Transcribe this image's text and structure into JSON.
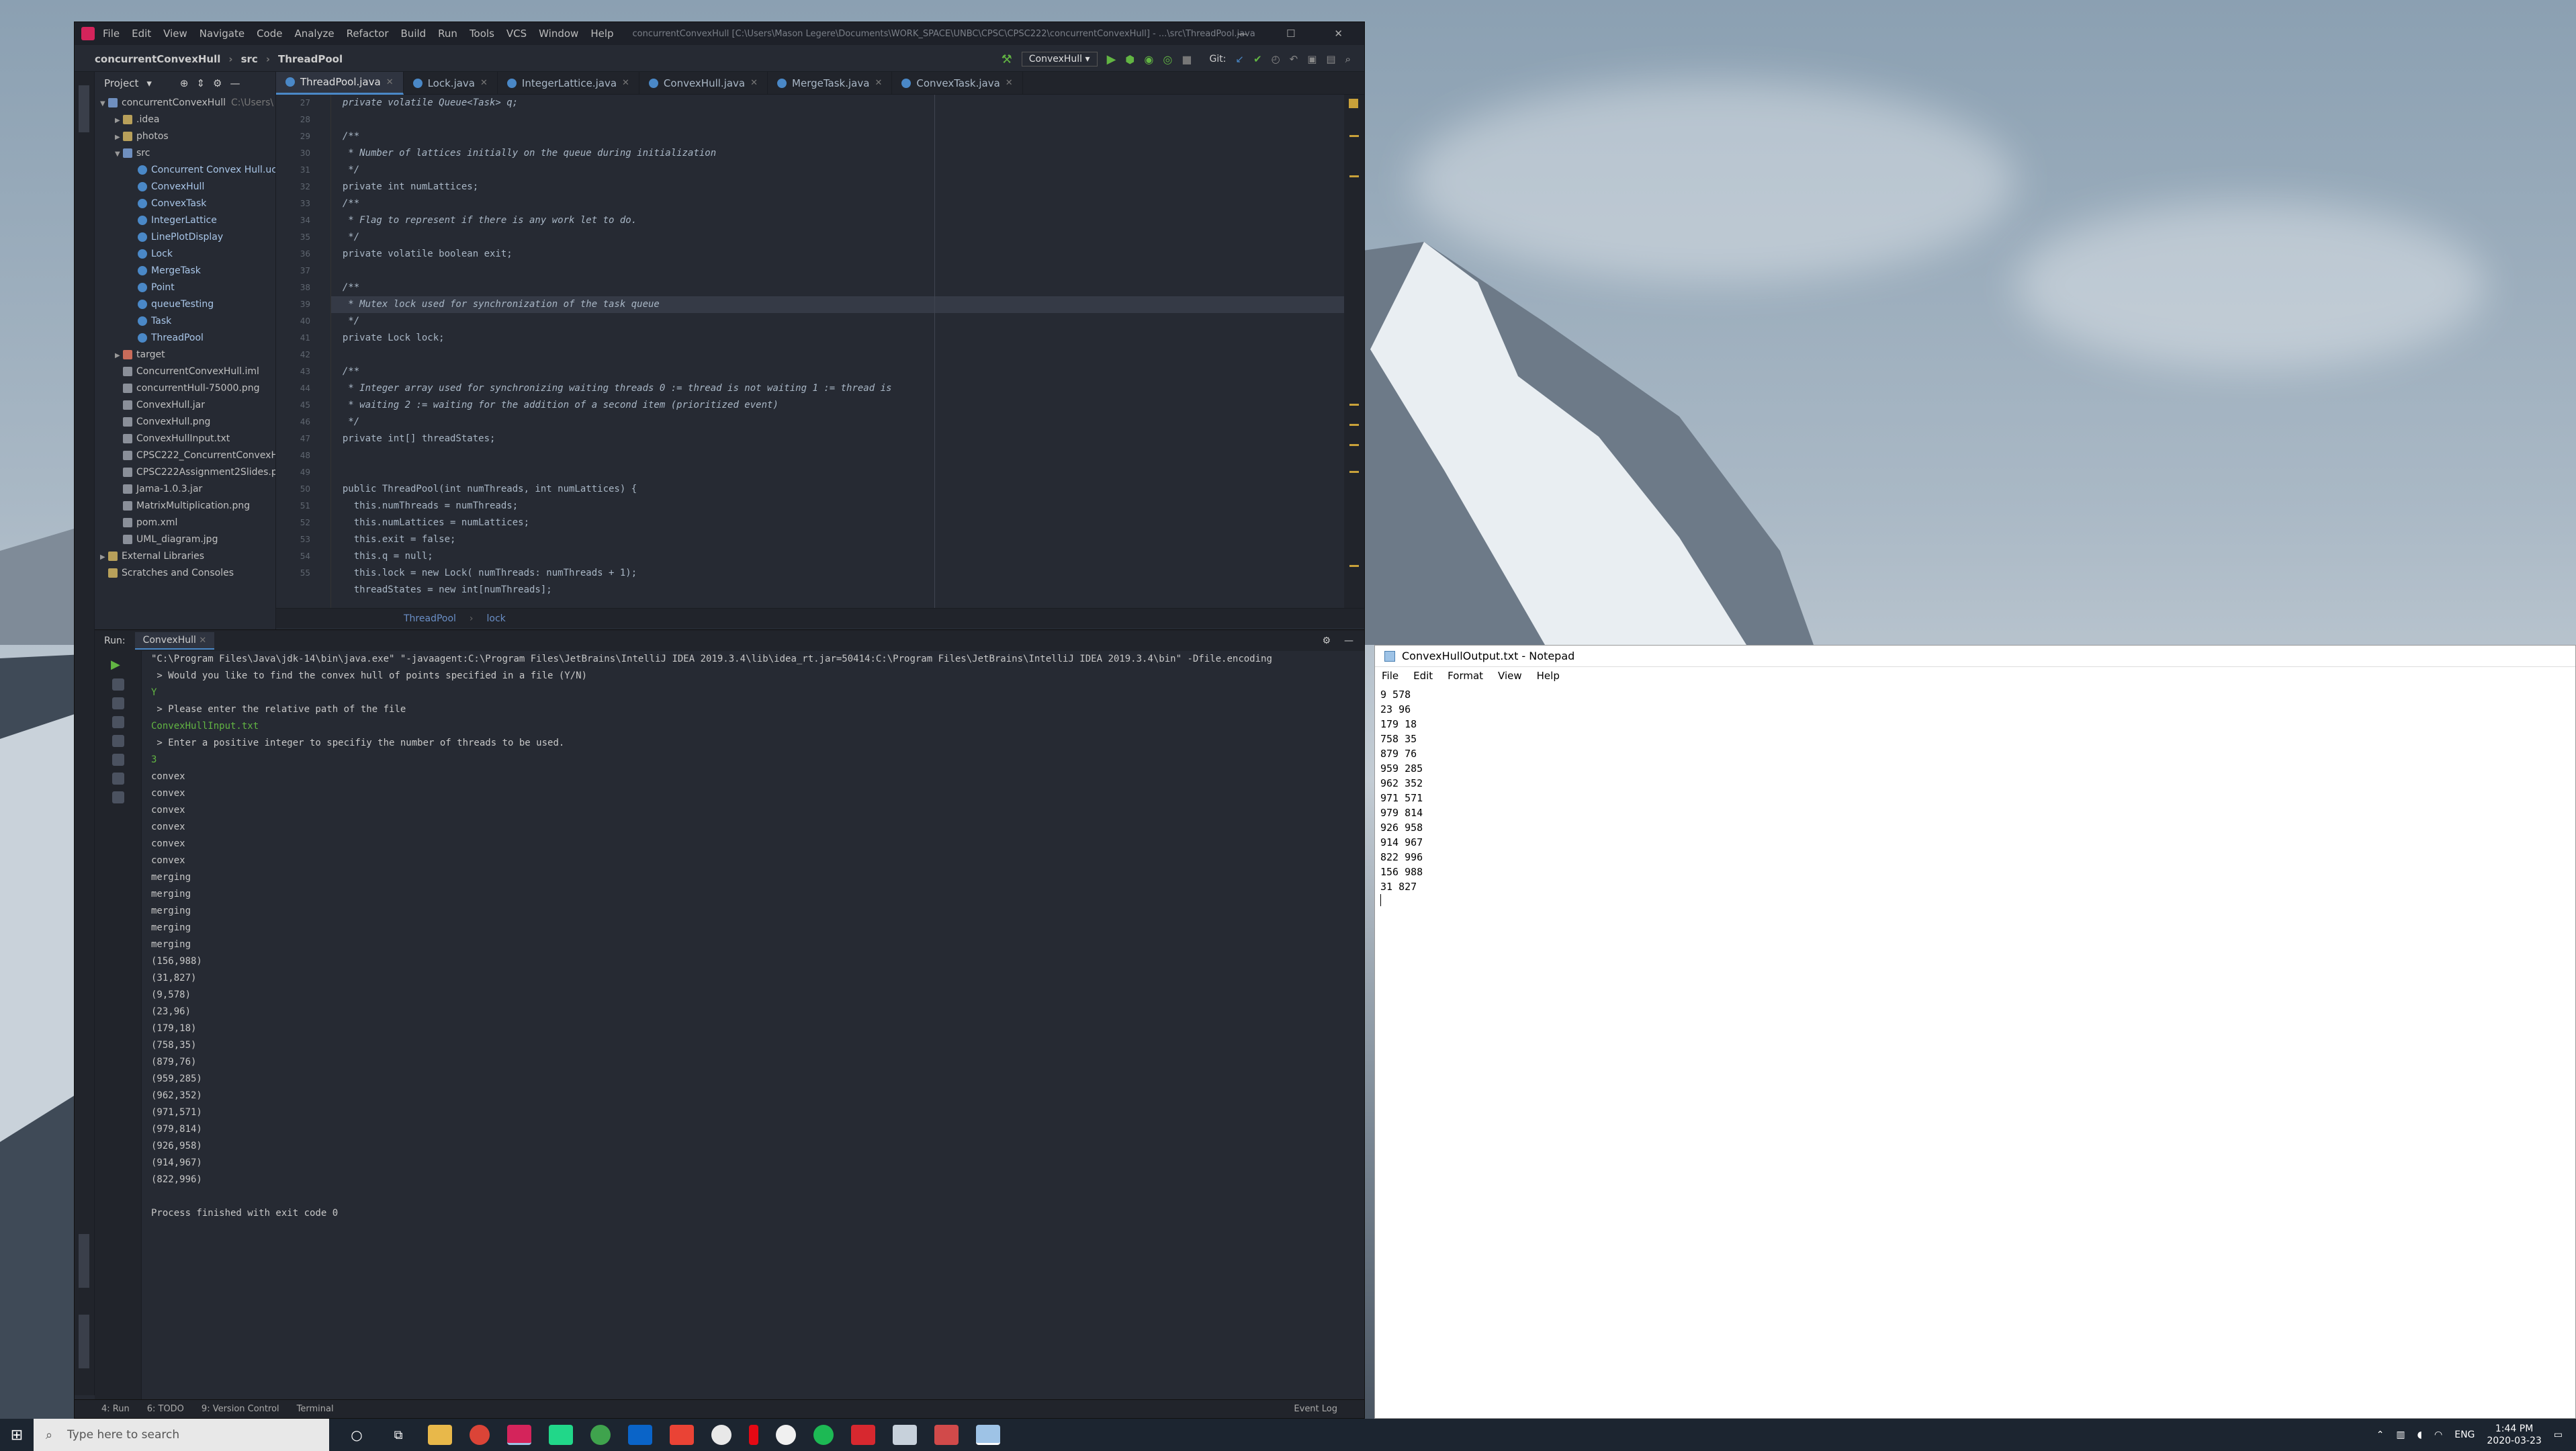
{
  "ide": {
    "menu": [
      "File",
      "Edit",
      "View",
      "Navigate",
      "Code",
      "Analyze",
      "Refactor",
      "Build",
      "Run",
      "Tools",
      "VCS",
      "Window",
      "Help"
    ],
    "title_path": "concurrentConvexHull [C:\\Users\\Mason Legere\\Documents\\WORK_SPACE\\UNBC\\CPSC\\CPSC222\\concurrentConvexHull] - ...\\src\\ThreadPool.java",
    "breadcrumb": [
      "concurrentConvexHull",
      "src",
      "ThreadPool"
    ],
    "run_config": "ConvexHull",
    "git_label": "Git:",
    "tabs": [
      "ThreadPool.java",
      "Lock.java",
      "IntegerLattice.java",
      "ConvexHull.java",
      "MergeTask.java",
      "ConvexTask.java"
    ],
    "project_label": "Project",
    "tree": [
      {
        "indent": 0,
        "arrow": "▼",
        "icon": "folder blue",
        "label": "concurrentConvexHull",
        "note": "C:\\Users\\"
      },
      {
        "indent": 1,
        "arrow": "▶",
        "icon": "folder",
        "label": ".idea"
      },
      {
        "indent": 1,
        "arrow": "▶",
        "icon": "folder",
        "label": "photos"
      },
      {
        "indent": 1,
        "arrow": "▼",
        "icon": "folder blue",
        "label": "src"
      },
      {
        "indent": 2,
        "arrow": "",
        "icon": "class",
        "label": "Concurrent Convex Hull.uc"
      },
      {
        "indent": 2,
        "arrow": "",
        "icon": "class",
        "label": "ConvexHull"
      },
      {
        "indent": 2,
        "arrow": "",
        "icon": "class",
        "label": "ConvexTask"
      },
      {
        "indent": 2,
        "arrow": "",
        "icon": "class",
        "label": "IntegerLattice"
      },
      {
        "indent": 2,
        "arrow": "",
        "icon": "class",
        "label": "LinePlotDisplay"
      },
      {
        "indent": 2,
        "arrow": "",
        "icon": "class",
        "label": "Lock"
      },
      {
        "indent": 2,
        "arrow": "",
        "icon": "class",
        "label": "MergeTask"
      },
      {
        "indent": 2,
        "arrow": "",
        "icon": "class",
        "label": "Point"
      },
      {
        "indent": 2,
        "arrow": "",
        "icon": "class",
        "label": "queueTesting"
      },
      {
        "indent": 2,
        "arrow": "",
        "icon": "class",
        "label": "Task"
      },
      {
        "indent": 2,
        "arrow": "",
        "icon": "class",
        "label": "ThreadPool"
      },
      {
        "indent": 1,
        "arrow": "▶",
        "icon": "folder red",
        "label": "target"
      },
      {
        "indent": 1,
        "arrow": "",
        "icon": "file",
        "label": "ConcurrentConvexHull.iml"
      },
      {
        "indent": 1,
        "arrow": "",
        "icon": "file",
        "label": "concurrentHull-75000.png"
      },
      {
        "indent": 1,
        "arrow": "",
        "icon": "file",
        "label": "ConvexHull.jar"
      },
      {
        "indent": 1,
        "arrow": "",
        "icon": "file",
        "label": "ConvexHull.png"
      },
      {
        "indent": 1,
        "arrow": "",
        "icon": "file",
        "label": "ConvexHullInput.txt"
      },
      {
        "indent": 1,
        "arrow": "",
        "icon": "file",
        "label": "CPSC222_ConcurrentConvexH"
      },
      {
        "indent": 1,
        "arrow": "",
        "icon": "file",
        "label": "CPSC222Assignment2Slides.p"
      },
      {
        "indent": 1,
        "arrow": "",
        "icon": "file",
        "label": "Jama-1.0.3.jar"
      },
      {
        "indent": 1,
        "arrow": "",
        "icon": "file",
        "label": "MatrixMultiplication.png"
      },
      {
        "indent": 1,
        "arrow": "",
        "icon": "file",
        "label": "pom.xml"
      },
      {
        "indent": 1,
        "arrow": "",
        "icon": "file",
        "label": "UML_diagram.jpg"
      },
      {
        "indent": 0,
        "arrow": "▶",
        "icon": "folder",
        "label": "External Libraries"
      },
      {
        "indent": 0,
        "arrow": "",
        "icon": "folder",
        "label": "Scratches and Consoles"
      }
    ],
    "line_numbers": [
      "27",
      "28",
      "29",
      "30",
      "31",
      "32",
      "33",
      "34",
      "35",
      "36",
      "37",
      "38",
      "39",
      "40",
      "41",
      "42",
      "43",
      "44",
      "45",
      "46",
      "47",
      "48",
      "49",
      "50",
      "51",
      "52",
      "53",
      "54",
      "55"
    ],
    "code": [
      {
        "t": "  private volatile Queue<Task> q;",
        "c": "cm"
      },
      {
        "t": "",
        "c": ""
      },
      {
        "t": "  /**",
        "c": "cm"
      },
      {
        "t": "   * Number of lattices initially on the queue during initialization",
        "c": "cm"
      },
      {
        "t": "   */",
        "c": "cm"
      },
      {
        "t": "  private int numLattices;",
        "c": ""
      },
      {
        "t": "  /**",
        "c": "cm"
      },
      {
        "t": "   * Flag to represent if there is any work let to do.",
        "c": "cm"
      },
      {
        "t": "   */",
        "c": "cm"
      },
      {
        "t": "  private volatile boolean exit;",
        "c": ""
      },
      {
        "t": "",
        "c": ""
      },
      {
        "t": "  /**",
        "c": "cm"
      },
      {
        "t": "   * Mutex lock used for synchronization of the task queue",
        "c": "cm hl"
      },
      {
        "t": "   */",
        "c": "cm"
      },
      {
        "t": "  private Lock lock;",
        "c": ""
      },
      {
        "t": "",
        "c": ""
      },
      {
        "t": "  /**",
        "c": "cm"
      },
      {
        "t": "   * Integer array used for synchronizing waiting threads 0 := thread is not waiting 1 := thread is",
        "c": "cm"
      },
      {
        "t": "   * waiting 2 := waiting for the addition of a second item (prioritized event)",
        "c": "cm"
      },
      {
        "t": "   */",
        "c": "cm"
      },
      {
        "t": "  private int[] threadStates;",
        "c": ""
      },
      {
        "t": "",
        "c": ""
      },
      {
        "t": "",
        "c": ""
      },
      {
        "t": "  public ThreadPool(int numThreads, int numLattices) {",
        "c": ""
      },
      {
        "t": "    this.numThreads = numThreads;",
        "c": ""
      },
      {
        "t": "    this.numLattices = numLattices;",
        "c": ""
      },
      {
        "t": "    this.exit = false;",
        "c": ""
      },
      {
        "t": "    this.q = null;",
        "c": ""
      },
      {
        "t": "    this.lock = new Lock( numThreads: numThreads + 1);",
        "c": ""
      },
      {
        "t": "    threadStates = new int[numThreads];",
        "c": ""
      }
    ],
    "editor_crumbs": [
      "ThreadPool",
      "lock"
    ],
    "run_label": "Run:",
    "run_tab": "ConvexHull",
    "console": [
      {
        "t": "\"C:\\Program Files\\Java\\jdk-14\\bin\\java.exe\" \"-javaagent:C:\\Program Files\\JetBrains\\IntelliJ IDEA 2019.3.4\\lib\\idea_rt.jar=50414:C:\\Program Files\\JetBrains\\IntelliJ IDEA 2019.3.4\\bin\" -Dfile.encoding",
        "c": ""
      },
      {
        "t": " > Would you like to find the convex hull of points specified in a file (Y/N)",
        "c": ""
      },
      {
        "t": "Y",
        "c": "inp"
      },
      {
        "t": " > Please enter the relative path of the file",
        "c": ""
      },
      {
        "t": "ConvexHullInput.txt",
        "c": "inp"
      },
      {
        "t": " > Enter a positive integer to specifiy the number of threads to be used.",
        "c": ""
      },
      {
        "t": "3",
        "c": "inp"
      },
      {
        "t": "convex",
        "c": ""
      },
      {
        "t": "convex",
        "c": ""
      },
      {
        "t": "convex",
        "c": ""
      },
      {
        "t": "convex",
        "c": ""
      },
      {
        "t": "convex",
        "c": ""
      },
      {
        "t": "convex",
        "c": ""
      },
      {
        "t": "merging",
        "c": ""
      },
      {
        "t": "merging",
        "c": ""
      },
      {
        "t": "merging",
        "c": ""
      },
      {
        "t": "merging",
        "c": ""
      },
      {
        "t": "merging",
        "c": ""
      },
      {
        "t": "(156,988)",
        "c": ""
      },
      {
        "t": "(31,827)",
        "c": ""
      },
      {
        "t": "(9,578)",
        "c": ""
      },
      {
        "t": "(23,96)",
        "c": ""
      },
      {
        "t": "(179,18)",
        "c": ""
      },
      {
        "t": "(758,35)",
        "c": ""
      },
      {
        "t": "(879,76)",
        "c": ""
      },
      {
        "t": "(959,285)",
        "c": ""
      },
      {
        "t": "(962,352)",
        "c": ""
      },
      {
        "t": "(971,571)",
        "c": ""
      },
      {
        "t": "(979,814)",
        "c": ""
      },
      {
        "t": "(926,958)",
        "c": ""
      },
      {
        "t": "(914,967)",
        "c": ""
      },
      {
        "t": "(822,996)",
        "c": ""
      },
      {
        "t": "",
        "c": ""
      },
      {
        "t": "Process finished with exit code 0",
        "c": ""
      }
    ],
    "status": [
      "4: Run",
      "6: TODO",
      "9: Version Control",
      "Terminal"
    ],
    "event_log": "Event Log"
  },
  "notepad": {
    "title": "ConvexHullOutput.txt - Notepad",
    "menu": [
      "File",
      "Edit",
      "Format",
      "View",
      "Help"
    ],
    "lines": [
      "9 578",
      "23 96",
      "179 18",
      "758 35",
      "879 76",
      "959 285",
      "962 352",
      "971 571",
      "979 814",
      "926 958",
      "914 967",
      "822 996",
      "156 988",
      "31 827"
    ]
  },
  "taskbar": {
    "search_placeholder": "Type here to search",
    "lang": "ENG",
    "time": "1:44 PM",
    "date": "2020-03-23"
  }
}
